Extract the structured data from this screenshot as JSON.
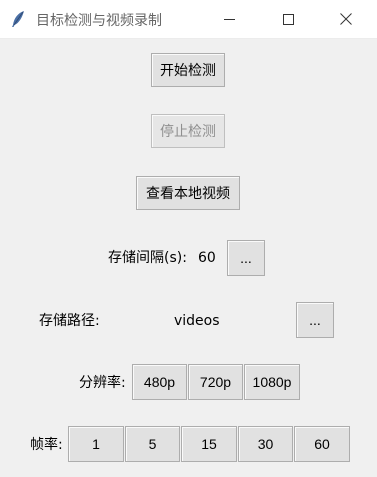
{
  "window": {
    "title": "目标检测与视频录制",
    "minimize_symbol": "—",
    "maximize_symbol": "☐",
    "close_symbol": "✕",
    "app_icon": "feather-icon"
  },
  "controls": {
    "start_detect": "开始检测",
    "stop_detect": "停止检测",
    "view_local_video": "查看本地视频"
  },
  "interval": {
    "label": "存储间隔(s):",
    "value": "60",
    "button": "..."
  },
  "storage_path": {
    "label": "存储路径:",
    "value": "videos",
    "button": "..."
  },
  "resolution": {
    "label": "分辨率:",
    "options": [
      "480p",
      "720p",
      "1080p"
    ]
  },
  "framerate": {
    "label": "帧率:",
    "options": [
      "1",
      "5",
      "15",
      "30",
      "60"
    ]
  },
  "colors": {
    "button_face": "#e1e1e1",
    "button_border": "#adadad",
    "background": "#f0f0f0",
    "disabled_text": "#8f8f8f"
  }
}
